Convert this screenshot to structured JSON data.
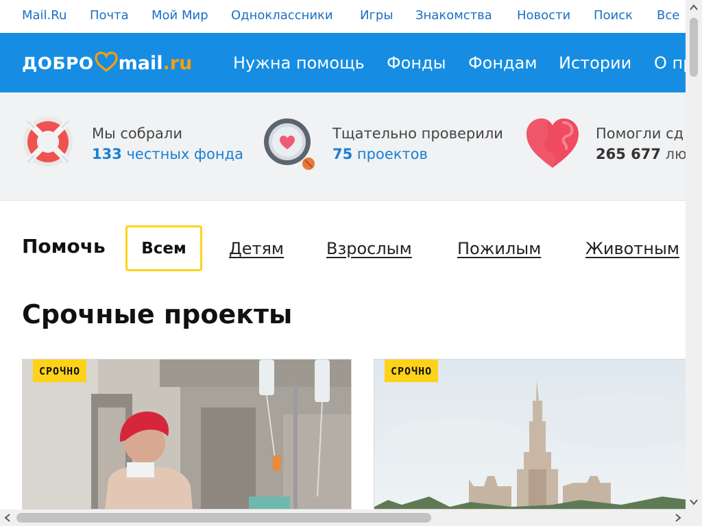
{
  "portal_nav": [
    "Mail.Ru",
    "Почта",
    "Мой Мир",
    "Одноклассники",
    "Игры",
    "Знакомства",
    "Новости",
    "Поиск",
    "Все"
  ],
  "logo": {
    "left": "ДОБРО",
    "mail": "mail",
    "ru": ".ru"
  },
  "main_nav": [
    "Нужна помощь",
    "Фонды",
    "Фондам",
    "Истории",
    "О пр"
  ],
  "stats": [
    {
      "label": "Мы собрали",
      "number": "133",
      "rest": " честных фонда",
      "icon": "lifebuoy-icon"
    },
    {
      "label": "Тщательно проверили",
      "number": "75",
      "rest": " проектов",
      "icon": "magnifier-heart-icon"
    },
    {
      "label": "Помогли сд",
      "number": "265 677",
      "rest": " люд",
      "icon": "heart-icon"
    }
  ],
  "help": {
    "title": "Помочь",
    "active": "Всем",
    "options": [
      "Детям",
      "Взрослым",
      "Пожилым",
      "Животным"
    ]
  },
  "urgent_title": "Срочные проекты",
  "cards": [
    {
      "badge": "СРОЧНО"
    },
    {
      "badge": "СРОЧНО"
    }
  ],
  "colors": {
    "header_blue": "#168de2",
    "link_blue": "#1a6fc4",
    "badge_yellow": "#ffd21a",
    "logo_orange": "#ff9e00"
  }
}
